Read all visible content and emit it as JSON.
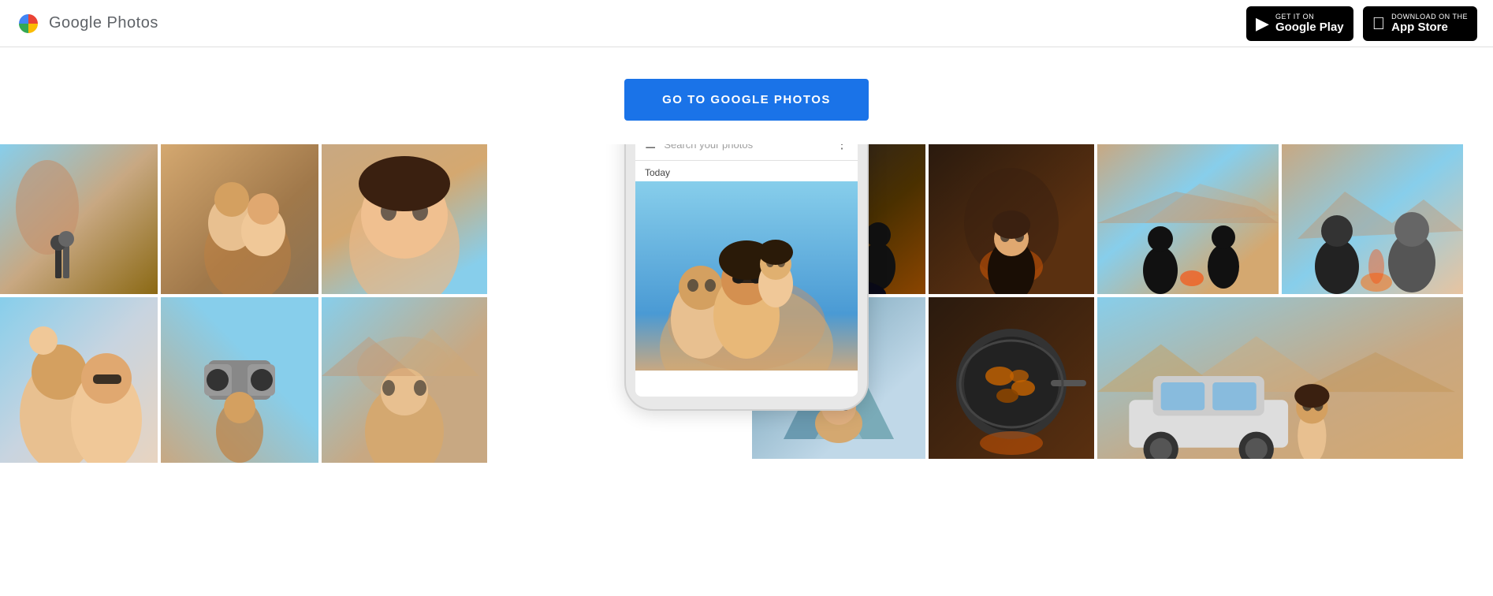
{
  "header": {
    "logo_text": "Google Photos",
    "google_play_badge": {
      "get_it_on": "GET IT ON",
      "store_name": "Google Play"
    },
    "app_store_badge": {
      "download_on": "Download on the",
      "store_name": "App Store"
    }
  },
  "main": {
    "cta_button_label": "GO TO GOOGLE PHOTOS"
  },
  "phone_ui": {
    "search_placeholder": "Search your photos",
    "today_label": "Today"
  }
}
